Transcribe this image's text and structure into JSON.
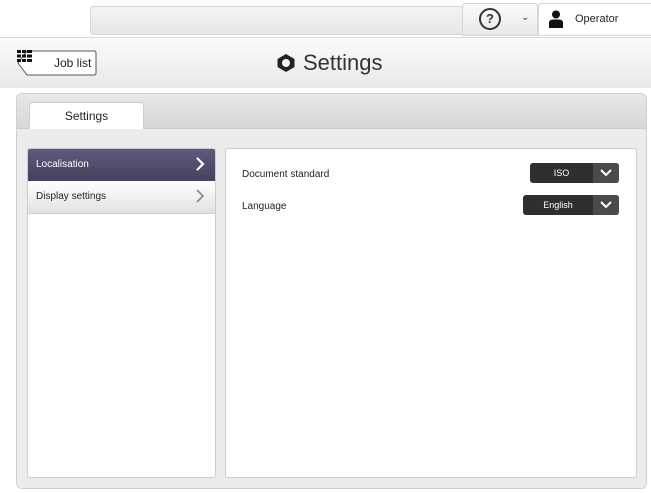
{
  "topbar": {
    "help_icon": "help-circle-icon",
    "help_symbol": "?",
    "user_icon": "user-icon",
    "user_label": "Operator"
  },
  "header": {
    "back_label": "Job list",
    "back_icon": "grid-icon",
    "title": "Settings",
    "title_icon": "gear-icon"
  },
  "tabs": [
    {
      "label": "Settings",
      "active": true
    }
  ],
  "sidebar": {
    "items": [
      {
        "label": "Localisation",
        "active": true
      },
      {
        "label": "Display settings",
        "active": false
      }
    ]
  },
  "settings": {
    "document_standard": {
      "label": "Document standard",
      "value": "ISO"
    },
    "language": {
      "label": "Language",
      "value": "English"
    }
  },
  "colors": {
    "active_nav": "#4f4b6c",
    "dropdown_bg": "#2f2f2f"
  }
}
